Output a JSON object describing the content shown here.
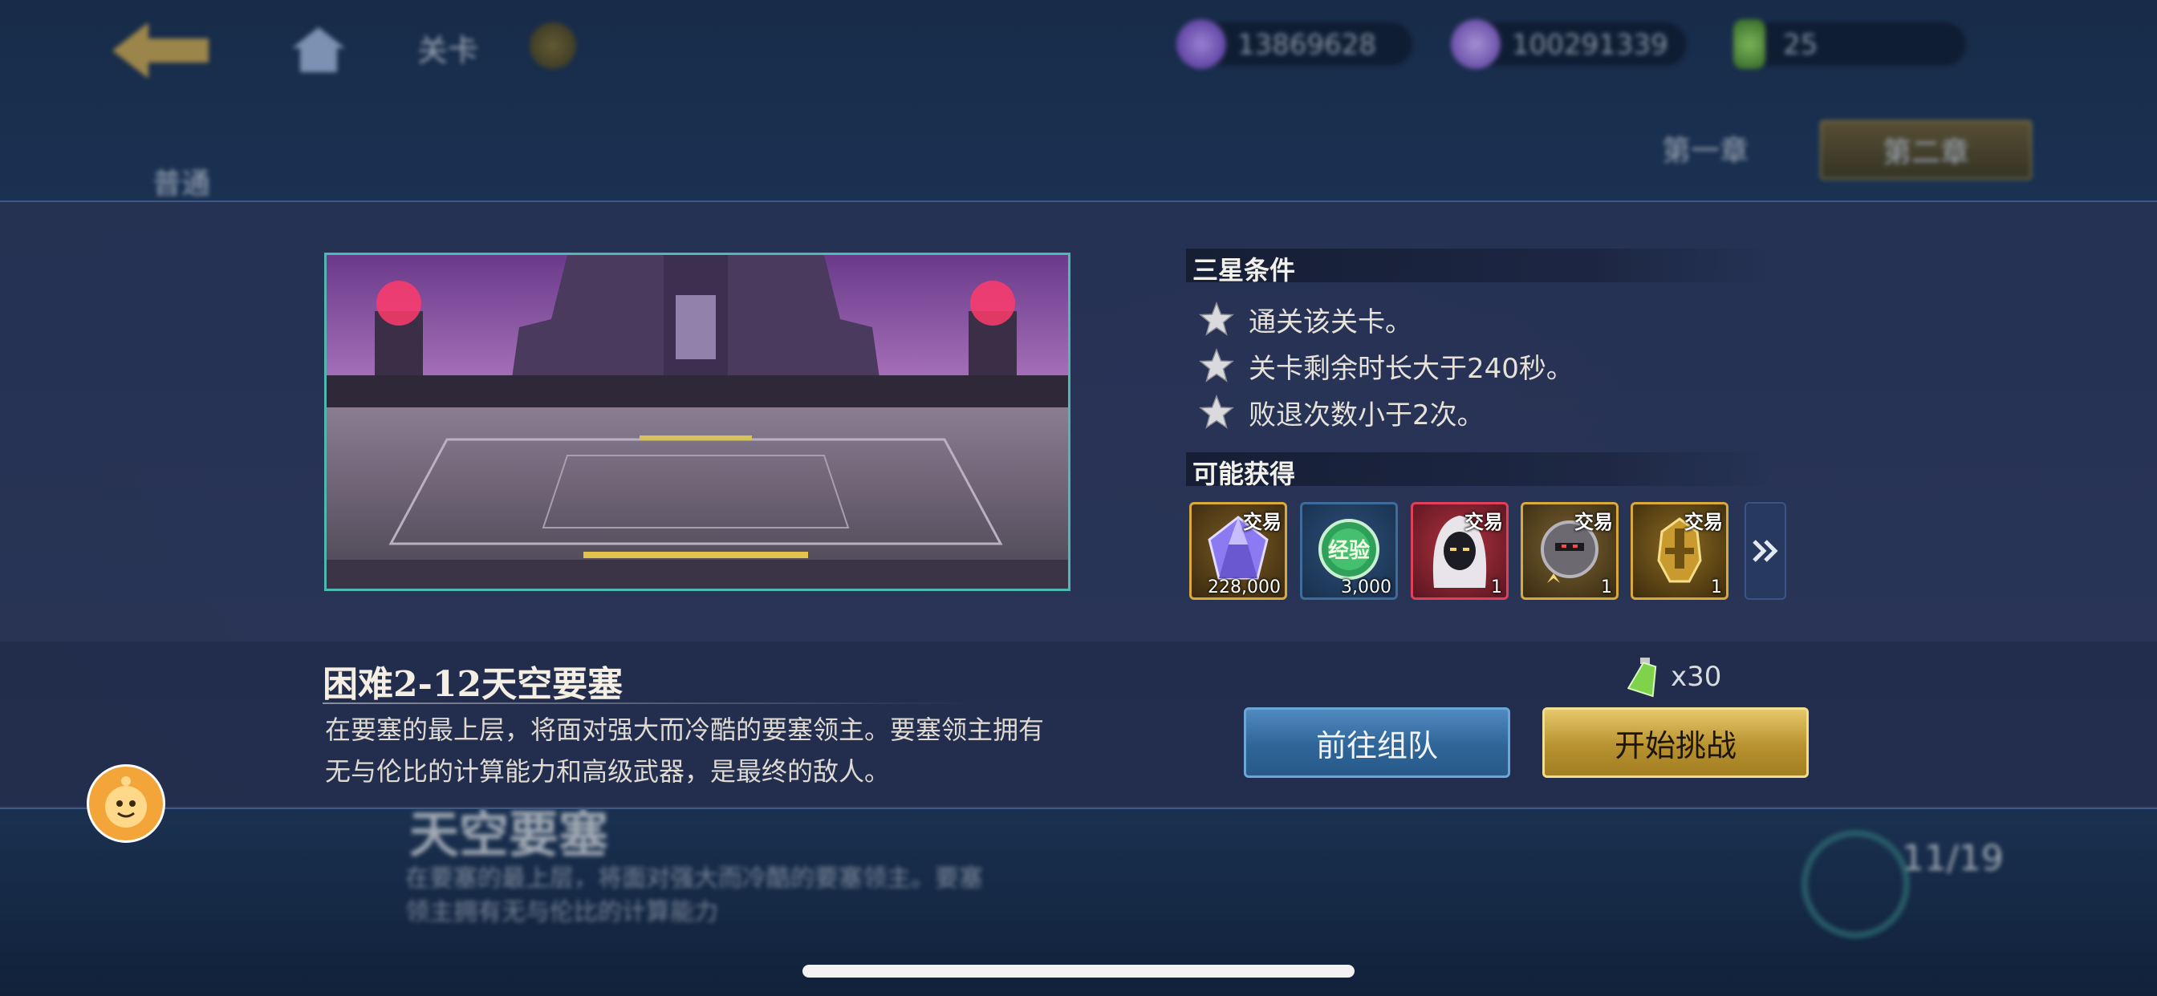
{
  "background": {
    "top_title": "关卡",
    "resources": [
      {
        "icon": "purple-gem-icon",
        "value": "13869628"
      },
      {
        "icon": "purple-crystal-icon",
        "value": "100291339"
      },
      {
        "icon": "stamina-potion-icon",
        "value": "25"
      }
    ],
    "tabs": [
      "第一章",
      "第二章"
    ],
    "left_tab": "普通",
    "bottom_title": "天空要塞",
    "bottom_desc": "在要塞的最上层，将面对强大而冷酷的要塞领主。要塞领主拥有无与伦比的计算能力",
    "bottom_count": "11/19"
  },
  "panel": {
    "three_star_header": "三星条件",
    "conditions": [
      "通关该关卡。",
      "关卡剩余时长大于240秒。",
      "败退次数小于2次。"
    ],
    "rewards_header": "可能获得",
    "rewards": [
      {
        "icon": "purple-crystal-icon",
        "badge": "交易",
        "qty": "228,000",
        "frame": "gold"
      },
      {
        "icon": "exp-orb-icon",
        "badge": "",
        "qty": "3,000",
        "frame": "blue"
      },
      {
        "icon": "hooded-hero-icon",
        "badge": "交易",
        "qty": "1",
        "frame": "red"
      },
      {
        "icon": "armored-hero-icon",
        "badge": "交易",
        "qty": "1",
        "frame": "gold"
      },
      {
        "icon": "golden-helmet-icon",
        "badge": "交易",
        "qty": "1",
        "frame": "gold"
      }
    ],
    "exp_label": "经验",
    "stage_title": "困难2-12天空要塞",
    "stage_desc": "在要塞的最上层，将面对强大而冷酷的要塞领主。要塞领主拥有无与伦比的计算能力和高级武器，是最终的敌人。",
    "stamina_cost": "x30",
    "team_button": "前往组队",
    "start_button": "开始挑战"
  },
  "colors": {
    "panel_bg": "#2a3558",
    "image_border": "#4fb8b2",
    "team_button": "#2f6598",
    "start_button": "#b8922f",
    "gold_frame": "#d9a93a",
    "red_frame": "#e0405a"
  }
}
